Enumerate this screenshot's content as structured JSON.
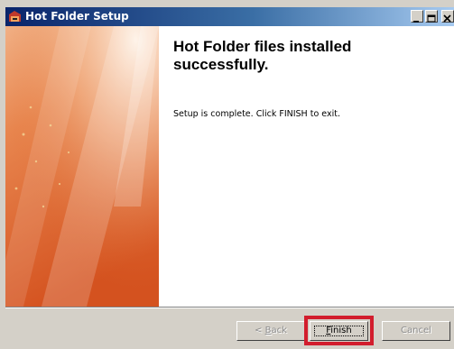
{
  "window": {
    "title": "Hot Folder Setup",
    "title_bar_gradient": [
      "#0a246a",
      "#a6caf0"
    ]
  },
  "titlebar_buttons": {
    "minimize": "minimize-icon",
    "maximize": "maximize-icon",
    "close": "close-icon"
  },
  "content": {
    "heading": "Hot Folder files installed successfully.",
    "body": "Setup is complete. Click FINISH to exit."
  },
  "buttons": {
    "back_prefix": "< ",
    "back_mnemonic": "B",
    "back_rest": "ack",
    "finish_mnemonic": "F",
    "finish_rest": "inish",
    "cancel": "Cancel"
  },
  "colors": {
    "highlight": "#d21d2d",
    "side_image_orange": "#e06a2a"
  }
}
